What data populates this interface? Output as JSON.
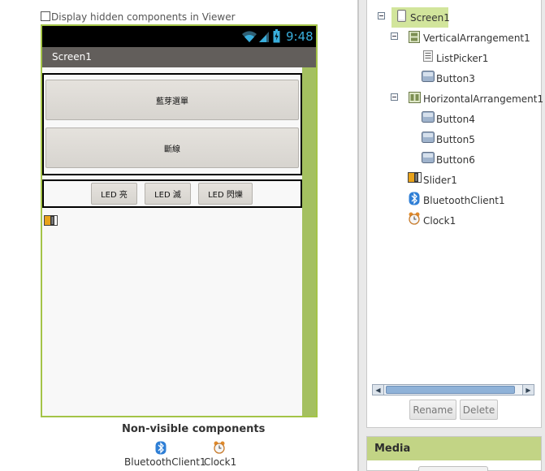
{
  "viewer": {
    "hidden_checkbox_label": "Display hidden components in Viewer",
    "hidden_checkbox_checked": false,
    "status_time": "9:48",
    "screen_title": "Screen1",
    "buttons": {
      "listpicker": "藍芽選單",
      "button3": "斷線",
      "button4": "LED 亮",
      "button5": "LED 滅",
      "button6": "LED 閃爍"
    },
    "nonvisible_title": "Non-visible components",
    "nonvisible": [
      {
        "label": "BluetoothClient1",
        "icon": "bluetooth-icon"
      },
      {
        "label": "Clock1",
        "icon": "clock-icon"
      }
    ]
  },
  "components": {
    "tree": [
      {
        "label": "Screen1",
        "icon": "screen-icon",
        "selected": true
      },
      {
        "label": "VerticalArrangement1",
        "icon": "vertical-arrangement-icon"
      },
      {
        "label": "ListPicker1",
        "icon": "listpicker-icon"
      },
      {
        "label": "Button3",
        "icon": "button-icon"
      },
      {
        "label": "HorizontalArrangement1",
        "icon": "horizontal-arrangement-icon"
      },
      {
        "label": "Button4",
        "icon": "button-icon"
      },
      {
        "label": "Button5",
        "icon": "button-icon"
      },
      {
        "label": "Button6",
        "icon": "button-icon"
      },
      {
        "label": "Slider1",
        "icon": "slider-icon"
      },
      {
        "label": "BluetoothClient1",
        "icon": "bluetooth-icon"
      },
      {
        "label": "Clock1",
        "icon": "clock-icon"
      }
    ],
    "rename_label": "Rename",
    "delete_label": "Delete"
  },
  "media": {
    "title": "Media"
  },
  "colors": {
    "phone_border": "#a4c447",
    "selected_highlight": "#d2e59c",
    "media_header": "#c2d485",
    "status_time": "#39aedc"
  }
}
